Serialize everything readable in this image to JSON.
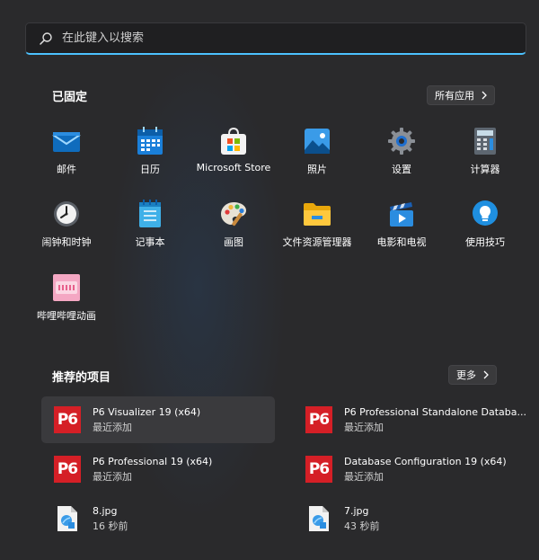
{
  "search": {
    "placeholder": "在此键入以搜索"
  },
  "pinned": {
    "title": "已固定",
    "all_apps_label": "所有应用",
    "apps": [
      {
        "label": "邮件",
        "icon": "mail-icon"
      },
      {
        "label": "日历",
        "icon": "calendar-icon"
      },
      {
        "label": "Microsoft Store",
        "icon": "store-icon"
      },
      {
        "label": "照片",
        "icon": "photos-icon"
      },
      {
        "label": "设置",
        "icon": "settings-gear-icon"
      },
      {
        "label": "计算器",
        "icon": "calculator-icon"
      },
      {
        "label": "闹钟和时钟",
        "icon": "clock-icon"
      },
      {
        "label": "记事本",
        "icon": "notepad-icon"
      },
      {
        "label": "画图",
        "icon": "paint-palette-icon"
      },
      {
        "label": "文件资源管理器",
        "icon": "folder-icon"
      },
      {
        "label": "电影和电视",
        "icon": "movies-tv-icon"
      },
      {
        "label": "使用技巧",
        "icon": "tips-bulb-icon"
      },
      {
        "label": "哔哩哔哩动画",
        "icon": "bilibili-icon"
      }
    ]
  },
  "recommended": {
    "title": "推荐的项目",
    "more_label": "更多",
    "items": [
      {
        "name": "P6 Visualizer 19 (x64)",
        "sub": "最近添加",
        "icon": "p6-icon",
        "icon_text": "P6"
      },
      {
        "name": "P6 Professional Standalone Databa...",
        "sub": "最近添加",
        "icon": "p6-icon",
        "icon_text": "P6"
      },
      {
        "name": "P6 Professional 19 (x64)",
        "sub": "最近添加",
        "icon": "p6-icon",
        "icon_text": "P6"
      },
      {
        "name": "Database Configuration 19 (x64)",
        "sub": "最近添加",
        "icon": "p6-icon",
        "icon_text": "P6"
      },
      {
        "name": "8.jpg",
        "sub": "16 秒前",
        "icon": "image-file-icon"
      },
      {
        "name": "7.jpg",
        "sub": "43 秒前",
        "icon": "image-file-icon"
      }
    ]
  },
  "colors": {
    "accent": "#4cc2ff",
    "background": "#2a2a2c",
    "p6_red": "#d51f26"
  }
}
